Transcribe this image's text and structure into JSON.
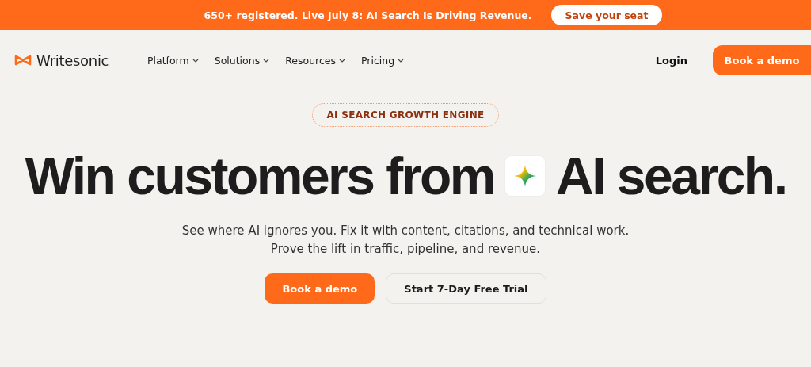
{
  "banner": {
    "text": "650+ registered. Live July 8: AI Search Is Driving Revenue.",
    "button": "Save your seat"
  },
  "nav": {
    "brand": "Writesonic",
    "items": [
      {
        "label": "Platform"
      },
      {
        "label": "Solutions"
      },
      {
        "label": "Resources"
      },
      {
        "label": "Pricing"
      }
    ],
    "login": "Login",
    "cta": "Book a demo"
  },
  "hero": {
    "badge": "AI SEARCH GROWTH ENGINE",
    "headline_before": "Win customers from",
    "headline_after": "AI search.",
    "subtitle_lines": [
      "See where AI ignores you. Fix it with content, citations, and technical work.",
      "Prove the lift in traffic, pipeline, and revenue."
    ],
    "buttons": [
      {
        "label": "Book a demo",
        "kind": "primary"
      },
      {
        "label": "Start 7-Day Free Trial",
        "kind": "secondary"
      }
    ]
  }
}
